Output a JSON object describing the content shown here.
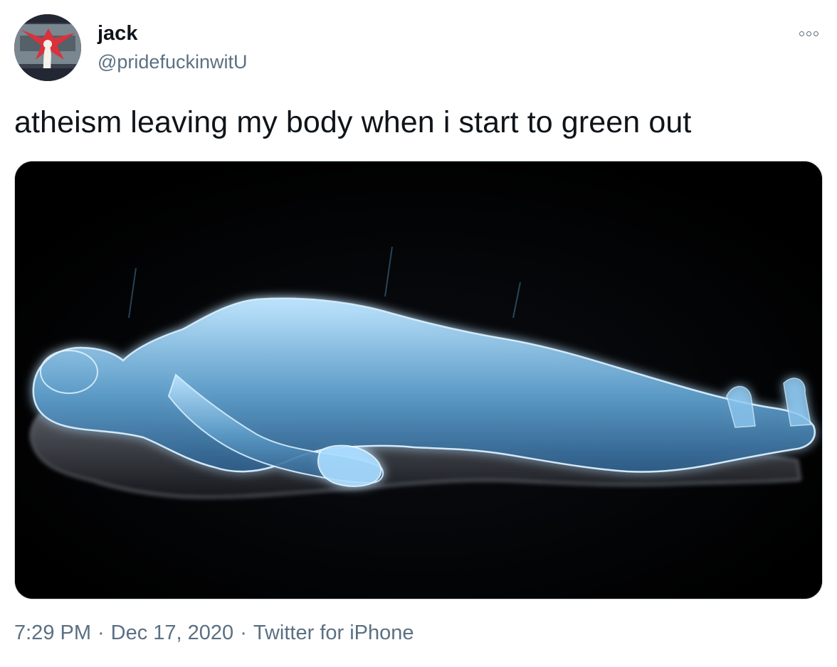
{
  "author": {
    "display_name": "jack",
    "handle": "@pridefuckinwitU",
    "avatar_icon": "avatar-image"
  },
  "menu": {
    "more_icon": "more-options-icon"
  },
  "tweet": {
    "text": "atheism leaving my body when i start to green out"
  },
  "media": {
    "icon": "astral-projection-image"
  },
  "meta": {
    "time": "7:29 PM",
    "separator": "·",
    "date": "Dec 17, 2020",
    "source": "Twitter for iPhone"
  },
  "colors": {
    "text": "#0f1419",
    "secondary": "#5b7083",
    "border": "#cfd9de",
    "glow": "#8fd0ff"
  }
}
